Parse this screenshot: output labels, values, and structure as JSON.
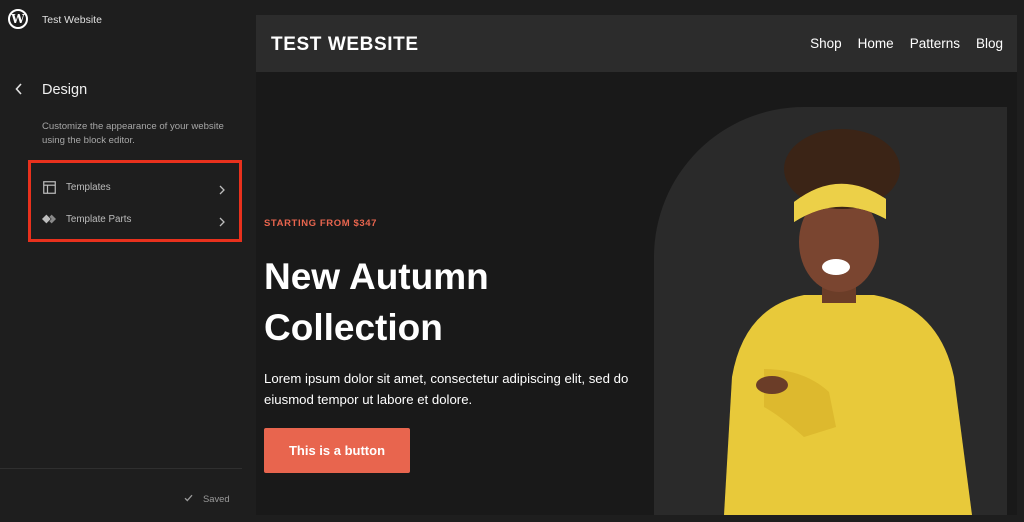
{
  "app": {
    "site_title": "Test Website"
  },
  "sidebar": {
    "title": "Design",
    "description": "Customize the appearance of your website using the block editor.",
    "items": [
      {
        "label": "Templates",
        "icon": "layout-icon"
      },
      {
        "label": "Template Parts",
        "icon": "diamond-icon"
      }
    ],
    "status": "Saved"
  },
  "preview": {
    "brand": "TEST WEBSITE",
    "nav": [
      "Shop",
      "Home",
      "Patterns",
      "Blog"
    ],
    "eyebrow": "STARTING FROM $347",
    "headline": "New Autumn Collection",
    "body": "Lorem ipsum dolor sit amet, consectetur adipiscing elit, sed do eiusmod tempor ut labore et dolore.",
    "button": "This is a button"
  },
  "colors": {
    "sidebar_bg": "#1e1e1e",
    "highlight_border": "#e8311d",
    "accent": "#e8654e",
    "preview_bg": "#191919",
    "header_bg": "#2c2c2c"
  }
}
